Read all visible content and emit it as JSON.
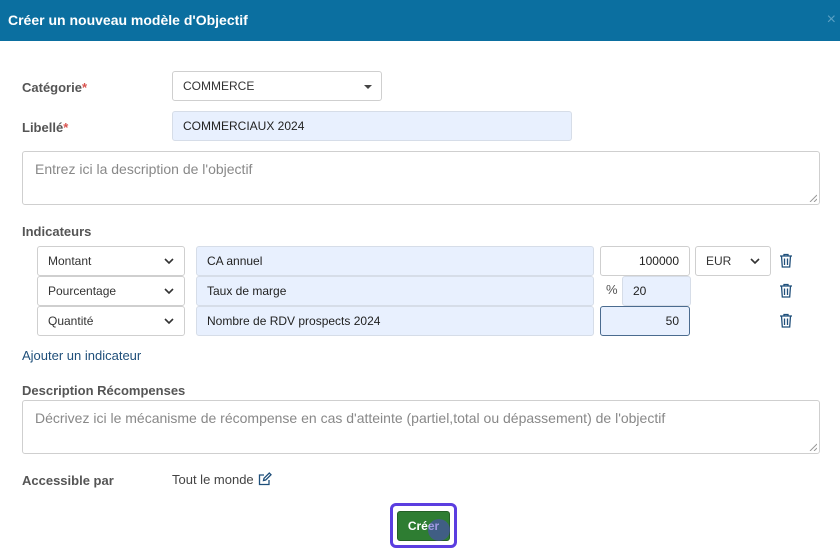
{
  "dialog": {
    "title": "Créer un nouveau modèle d'Objectif",
    "close_symbol": "×"
  },
  "form": {
    "category": {
      "label": "Catégorie",
      "required_mark": "*",
      "value": "COMMERCE"
    },
    "label_field": {
      "label": "Libellé",
      "required_mark": "*",
      "value": "COMMERCIAUX 2024"
    },
    "description": {
      "placeholder": "Entrez ici la description de l'objectif"
    },
    "indicators": {
      "label": "Indicateurs",
      "rows": [
        {
          "type": "Montant",
          "name": "CA annuel",
          "value": "100000",
          "unit": "EUR"
        },
        {
          "type": "Pourcentage",
          "name": "Taux de marge",
          "prefix": "%",
          "value": "20"
        },
        {
          "type": "Quantité",
          "name": "Nombre de RDV prospects 2024",
          "value": "50"
        }
      ],
      "add_link": "Ajouter un indicateur"
    },
    "rewards": {
      "label": "Description Récompenses",
      "placeholder": "Décrivez ici le mécanisme de récompense en cas d'atteinte (partiel,total ou dépassement) de l'objectif"
    },
    "accessible": {
      "label": "Accessible par",
      "value": "Tout le monde"
    }
  },
  "actions": {
    "create_label": "Créer"
  },
  "colors": {
    "header": "#0b6fa0",
    "primary_button": "#2e7d32",
    "focus_ring": "#5b3ee0",
    "required": "#d9534f",
    "filled_input": "#e8f0fe"
  }
}
